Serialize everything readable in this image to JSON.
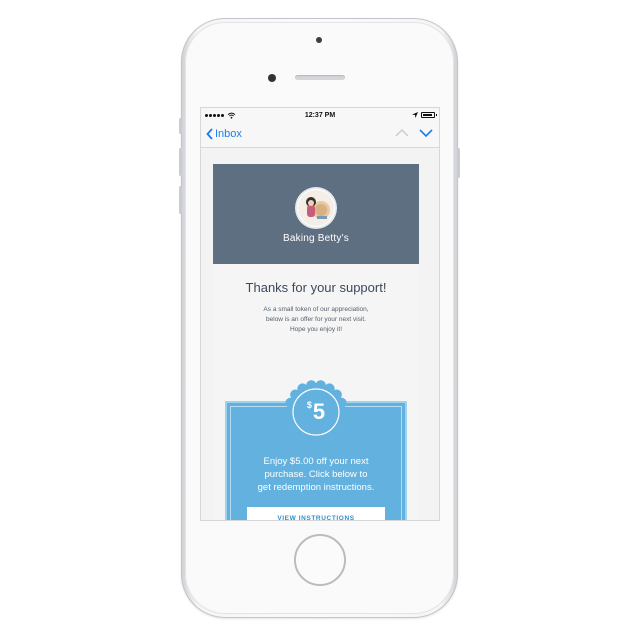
{
  "status_bar": {
    "time": "12:37 PM",
    "icons": [
      "signal-dots-icon",
      "wifi-icon",
      "location-arrow-icon",
      "battery-icon"
    ]
  },
  "nav": {
    "back_label": "Inbox",
    "icons": [
      "chevron-left-icon",
      "chevron-up-icon",
      "chevron-down-icon"
    ]
  },
  "email": {
    "brand_name": "Baking Betty’s",
    "title": "Thanks for your support!",
    "body_lines": [
      "As a small token of our appreciation,",
      "below is an offer for your next visit.",
      "Hope you enjoy it!"
    ],
    "coupon": {
      "currency": "$",
      "amount": "5",
      "text_lines": [
        "Enjoy $5.00 off your next",
        "purchase. Click below to",
        "get redemption instructions."
      ],
      "button_label": "VIEW INSTRUCTIONS"
    }
  },
  "colors": {
    "header_bg": "#5f6f82",
    "coupon_bg": "#62b1de",
    "link_blue": "#1a7cf0",
    "title_text": "#3b4a5c"
  }
}
